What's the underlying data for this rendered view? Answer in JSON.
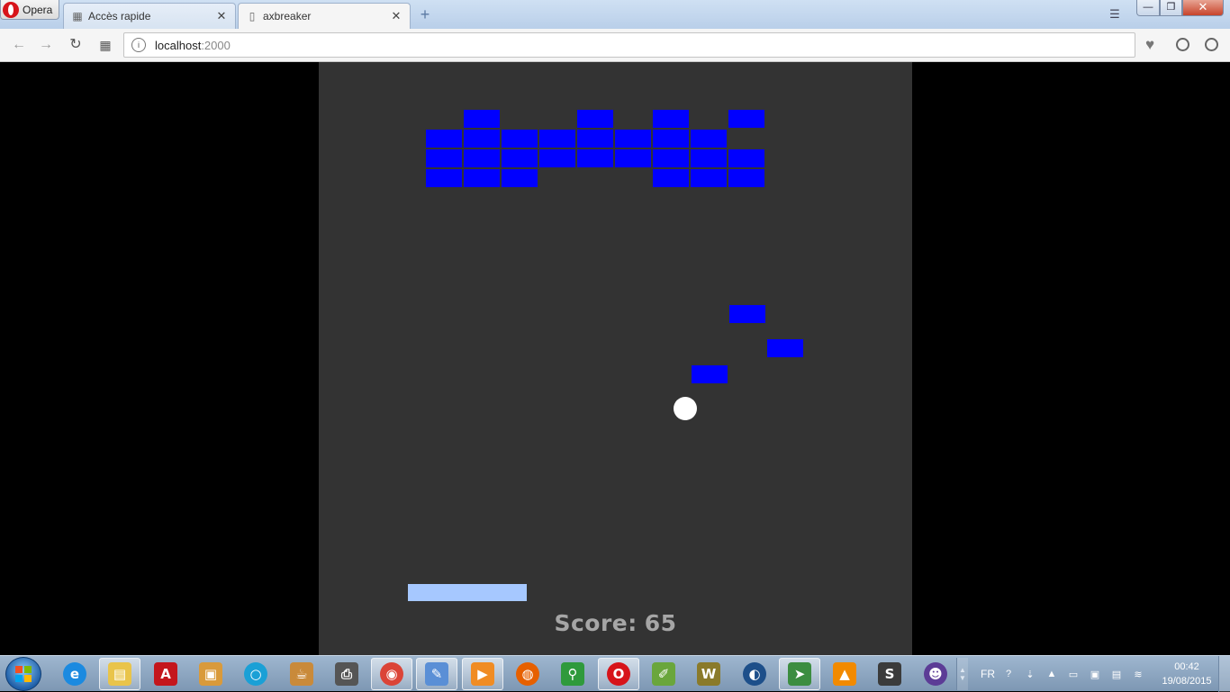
{
  "browser": {
    "menu_label": "Opera",
    "tabs": [
      {
        "label": "Accès rapide",
        "icon": "speed-dial-icon",
        "close": "✕"
      },
      {
        "label": "axbreaker",
        "icon": "document-icon",
        "close": "✕"
      }
    ],
    "new_tab_glyph": "+",
    "url_host": "localhost",
    "url_port": ":2000"
  },
  "game": {
    "score_label": "Score:",
    "score_value": "65",
    "colors": {
      "background": "#333333",
      "brick": "#0000ff",
      "paddle": "#a6c8ff",
      "ball": "#ffffff",
      "score_text": "#a6a6a6"
    },
    "bricks": [
      {
        "col": 1,
        "row": 0
      },
      {
        "col": 4,
        "row": 0
      },
      {
        "col": 6,
        "row": 0
      },
      {
        "col": 8,
        "row": 0
      },
      {
        "col": 0,
        "row": 1
      },
      {
        "col": 1,
        "row": 1
      },
      {
        "col": 2,
        "row": 1
      },
      {
        "col": 3,
        "row": 1
      },
      {
        "col": 4,
        "row": 1
      },
      {
        "col": 5,
        "row": 1
      },
      {
        "col": 6,
        "row": 1
      },
      {
        "col": 7,
        "row": 1
      },
      {
        "col": 0,
        "row": 2
      },
      {
        "col": 1,
        "row": 2
      },
      {
        "col": 2,
        "row": 2
      },
      {
        "col": 3,
        "row": 2
      },
      {
        "col": 4,
        "row": 2
      },
      {
        "col": 5,
        "row": 2
      },
      {
        "col": 6,
        "row": 2
      },
      {
        "col": 7,
        "row": 2
      },
      {
        "col": 8,
        "row": 2
      },
      {
        "col": 0,
        "row": 3
      },
      {
        "col": 1,
        "row": 3
      },
      {
        "col": 2,
        "row": 3
      },
      {
        "col": 6,
        "row": 3
      },
      {
        "col": 7,
        "row": 3
      },
      {
        "col": 8,
        "row": 3
      }
    ],
    "falling_bricks": 3
  },
  "taskbar": {
    "apps": [
      {
        "name": "internet-explorer",
        "glyph": "e",
        "color": "#1b8ae0",
        "shape": "circle"
      },
      {
        "name": "file-explorer",
        "glyph": "▤",
        "color": "#e9c44a",
        "shape": "square"
      },
      {
        "name": "adobe-reader",
        "glyph": "A",
        "color": "#c4161c",
        "shape": "square"
      },
      {
        "name": "image-viewer",
        "glyph": "▣",
        "color": "#d99a3b",
        "shape": "square"
      },
      {
        "name": "ring-app",
        "glyph": "○",
        "color": "#1aa0d6",
        "shape": "circle"
      },
      {
        "name": "coffee-app",
        "glyph": "☕",
        "color": "#c98a3a",
        "shape": "square"
      },
      {
        "name": "printer-app",
        "glyph": "⎙",
        "color": "#555555",
        "shape": "square"
      },
      {
        "name": "chrome",
        "glyph": "◉",
        "color": "#db4437",
        "shape": "circle"
      },
      {
        "name": "paint",
        "glyph": "✎",
        "color": "#5a8fd6",
        "shape": "square"
      },
      {
        "name": "media-player",
        "glyph": "▶",
        "color": "#f08c24",
        "shape": "square"
      },
      {
        "name": "firefox",
        "glyph": "◍",
        "color": "#e66000",
        "shape": "circle"
      },
      {
        "name": "green-app",
        "glyph": "⚲",
        "color": "#2f9a3c",
        "shape": "square"
      },
      {
        "name": "opera",
        "glyph": "O",
        "color": "#d7141a",
        "shape": "circle"
      },
      {
        "name": "notepad-plus",
        "glyph": "✐",
        "color": "#6aa63c",
        "shape": "square"
      },
      {
        "name": "bookmark-app",
        "glyph": "W",
        "color": "#8a7a2a",
        "shape": "square"
      },
      {
        "name": "audio-app",
        "glyph": "◐",
        "color": "#1d4f8a",
        "shape": "circle"
      },
      {
        "name": "paper-plane-app",
        "glyph": "➤",
        "color": "#3c8d40",
        "shape": "square"
      },
      {
        "name": "vlc",
        "glyph": "▲",
        "color": "#f28a00",
        "shape": "square"
      },
      {
        "name": "sublime-text",
        "glyph": "S",
        "color": "#3b3b3b",
        "shape": "square"
      },
      {
        "name": "cat-app",
        "glyph": "☻",
        "color": "#5c3c96",
        "shape": "circle"
      }
    ],
    "lang": "FR",
    "time": "00:42",
    "date": "19/08/2015"
  }
}
